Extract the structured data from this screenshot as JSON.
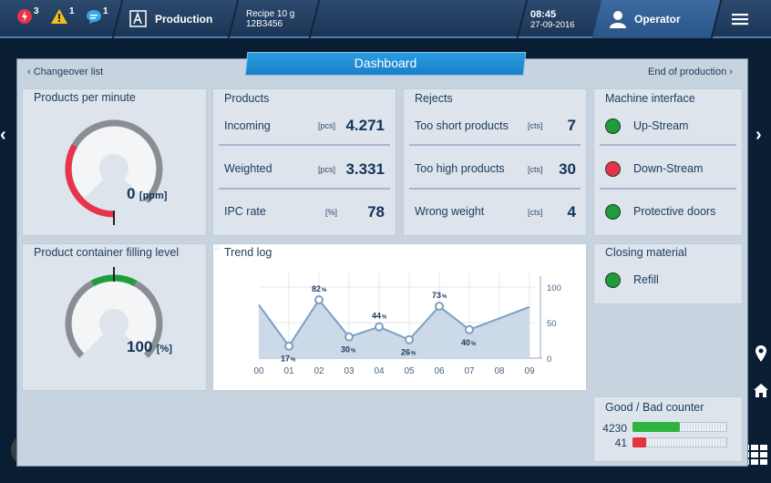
{
  "header": {
    "notifications": [
      {
        "icon": "error-icon",
        "count": "3"
      },
      {
        "icon": "warning-icon",
        "count": "1"
      },
      {
        "icon": "message-icon",
        "count": "1"
      }
    ],
    "mode_label": "Production",
    "recipe_title": "Recipe 10 g",
    "recipe_id": "12B3456",
    "time": "08:45",
    "date": "27-09-2016",
    "user": "Operator"
  },
  "nav": {
    "back_label": "Changeover list",
    "title": "Dashboard",
    "forward_label": "End of production"
  },
  "ppm": {
    "title": "Products per minute",
    "value": "0",
    "unit": "[ppm]",
    "level": 0
  },
  "products": {
    "title": "Products",
    "rows": [
      {
        "label": "Incoming",
        "unit": "[pcs]",
        "value": "4.271"
      },
      {
        "label": "Weighted",
        "unit": "[pcs]",
        "value": "3.331"
      },
      {
        "label": "IPC rate",
        "unit": "[%]",
        "value": "78"
      }
    ]
  },
  "rejects": {
    "title": "Rejects",
    "rows": [
      {
        "label": "Too short products",
        "unit": "[cts]",
        "value": "7"
      },
      {
        "label": "Too high products",
        "unit": "[cts]",
        "value": "30"
      },
      {
        "label": "Wrong weight",
        "unit": "[cts]",
        "value": "4"
      }
    ]
  },
  "machine": {
    "title": "Machine interface",
    "items": [
      {
        "label": "Up-Stream",
        "color": "#1e9e3a"
      },
      {
        "label": "Down-Stream",
        "color": "#e8334a"
      },
      {
        "label": "Protective doors",
        "color": "#1e9e3a"
      }
    ]
  },
  "container": {
    "title": "Product container filling level",
    "value": "100",
    "unit": "[%]",
    "level": 1.0
  },
  "trend": {
    "title": "Trend log"
  },
  "closing": {
    "title": "Closing material",
    "item": {
      "label": "Refill",
      "color": "#1e9e3a"
    }
  },
  "counter": {
    "title": "Good / Bad counter",
    "good": {
      "value": "4230",
      "fraction": 0.4,
      "color": "#2fb341"
    },
    "bad": {
      "value": "41",
      "fraction": 0.07,
      "color": "#e5323f"
    }
  },
  "colors": {
    "accent": "#1a8ad4",
    "gauge_red": "#e8334a",
    "gauge_green": "#1e9e3a"
  },
  "chart_data": {
    "type": "area",
    "title": "",
    "x": [
      "00",
      "01",
      "02",
      "03",
      "04",
      "05",
      "06",
      "07",
      "08",
      "09"
    ],
    "series": [
      {
        "values": [
          75,
          17,
          82,
          30,
          44,
          26,
          73,
          40,
          56,
          72
        ],
        "labels": [
          "",
          "17",
          "82",
          "30",
          "44",
          "26",
          "73",
          "40",
          "",
          ""
        ]
      }
    ],
    "label_unit": "%",
    "ylim": [
      0,
      100
    ],
    "yticks": [
      "0",
      "50",
      "100"
    ],
    "y_axis_side": "right",
    "grid": true
  }
}
